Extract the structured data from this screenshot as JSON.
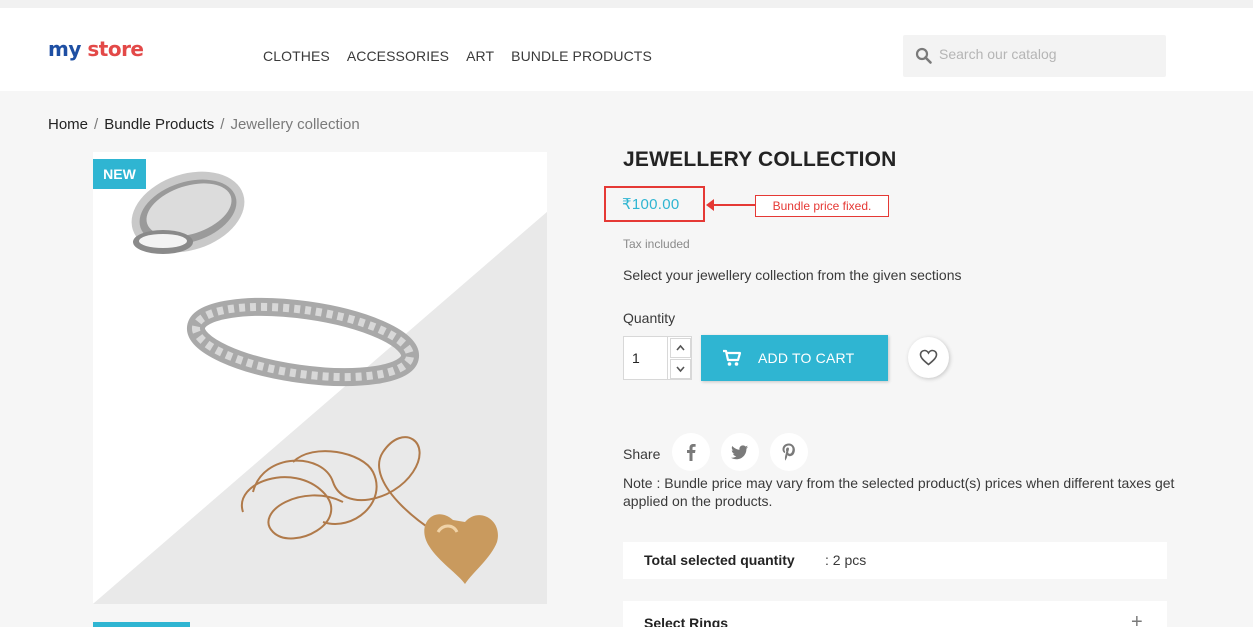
{
  "header": {
    "logo_part1": "my",
    "logo_part2": "store",
    "nav": [
      "CLOTHES",
      "ACCESSORIES",
      "ART",
      "BUNDLE PRODUCTS"
    ],
    "search_placeholder": "Search our catalog"
  },
  "breadcrumb": {
    "home": "Home",
    "category": "Bundle Products",
    "current": "Jewellery collection",
    "separator": "/"
  },
  "product": {
    "badge": "NEW",
    "title": "JEWELLERY COLLECTION",
    "price": "₹100.00",
    "annotation": "Bundle price fixed.",
    "tax_note": "Tax included",
    "description": "Select your jewellery collection from the given sections",
    "quantity_label": "Quantity",
    "quantity_value": "1",
    "add_to_cart": "ADD TO CART",
    "share_label": "Share",
    "note": "Note : Bundle price may vary from the selected product(s) prices when different taxes get applied on the products."
  },
  "panels": {
    "total_label": "Total selected quantity",
    "total_value": ": 2 pcs",
    "section_title": "Select Rings",
    "section_toggle": "+"
  },
  "colors": {
    "accent": "#2fb5d2",
    "annotation_red": "#e53935",
    "logo_blue": "#1e4fa3",
    "logo_red": "#e34948"
  },
  "icons": [
    "search-icon",
    "cart-icon",
    "heart-icon",
    "facebook-icon",
    "twitter-icon",
    "pinterest-icon",
    "caret-up-icon",
    "caret-down-icon"
  ]
}
